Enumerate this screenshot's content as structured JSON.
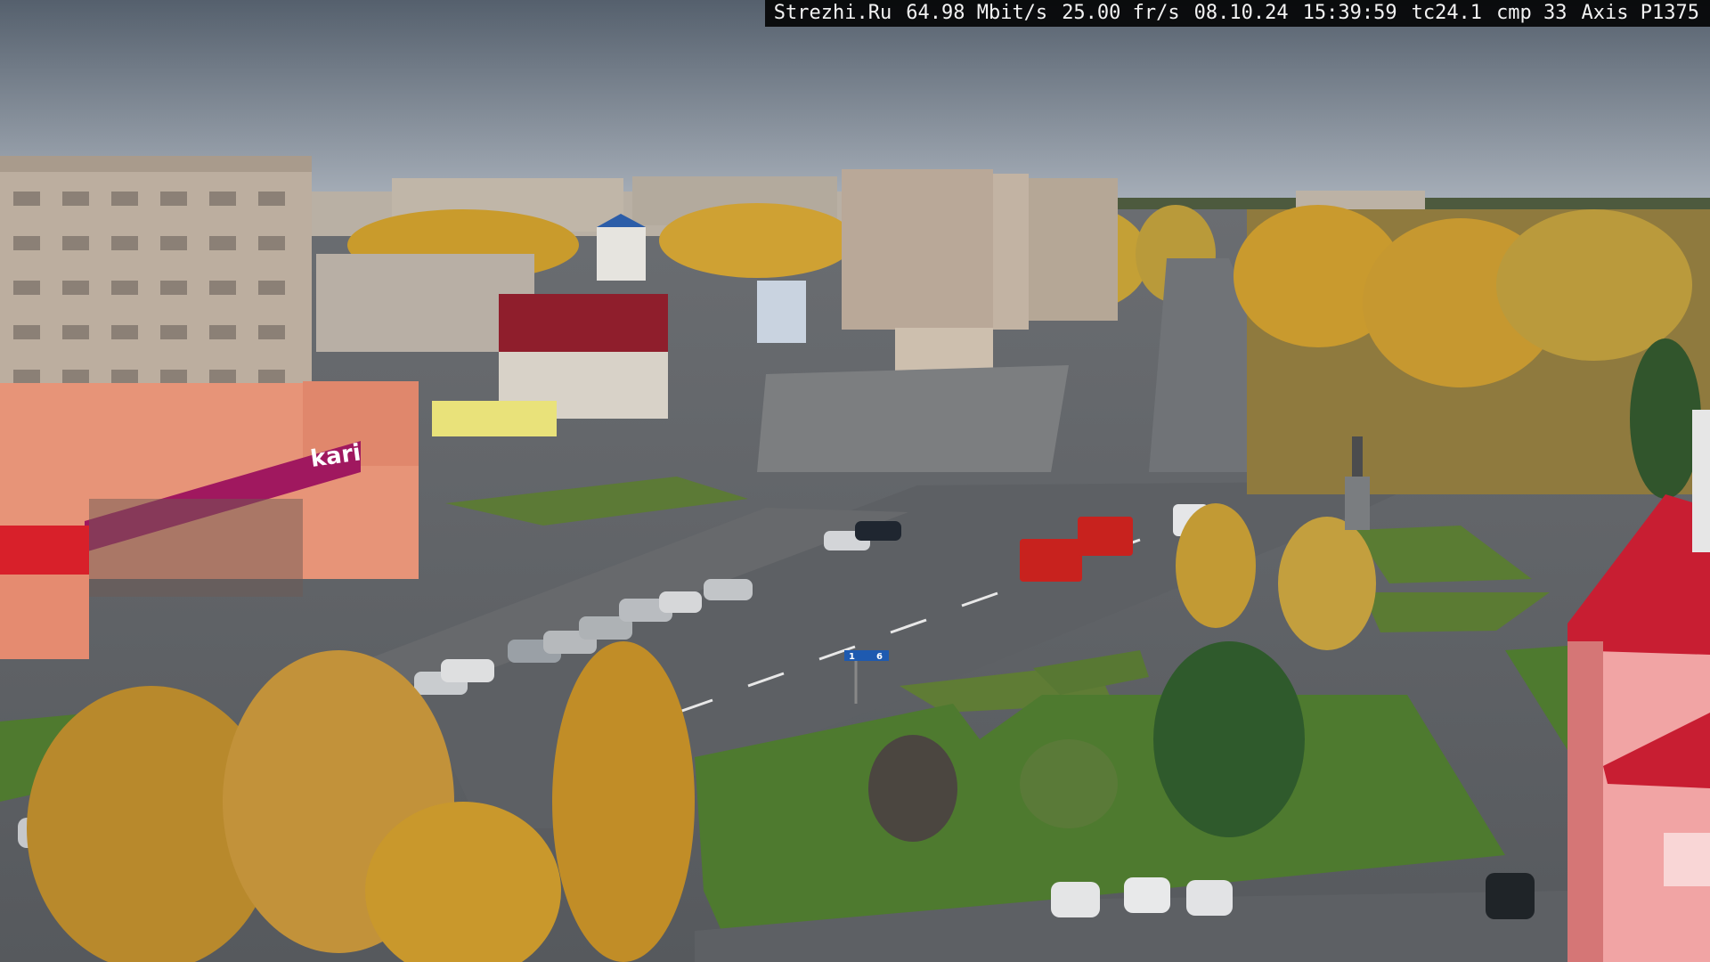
{
  "overlay": {
    "site": "Strezhi.Ru",
    "bitrate": "64.98 Mbit/s",
    "framerate": "25.00 fr/s",
    "date": "08.10.24",
    "time": "15:39:59",
    "tc": "tc24.1",
    "cmp": "cmp 33",
    "camera": "Axis P1375"
  },
  "scene_text": {
    "store_sign": "kari",
    "road_sign_left": "1",
    "road_sign_right": "6"
  },
  "colors": {
    "sky_top": "#56606d",
    "sky_bottom": "#a9b1bb",
    "asphalt": "#5f6266",
    "grass": "#4f7a34",
    "autumn_tree": "#c9952a",
    "store_magenta": "#a0185f",
    "building_beige": "#b8ab9a",
    "fire_truck": "#c8221e"
  }
}
